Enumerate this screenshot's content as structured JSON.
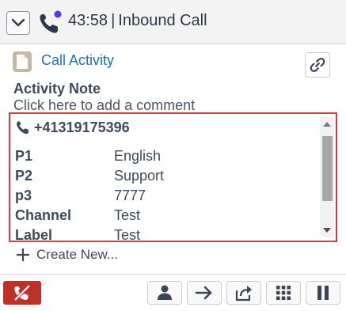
{
  "header": {
    "timer": "43:58",
    "separator": "|",
    "call_type": "Inbound Call",
    "status_dot_color": "#4a3fe0",
    "icon": "phone-icon"
  },
  "activity": {
    "link_label": "Call Activity",
    "note_label": "Activity Note",
    "note_placeholder": "Click here to add a comment",
    "icon": "document-icon",
    "link_button_icon": "link-icon"
  },
  "call_info": {
    "phone_number": "+41319175396",
    "attributes": [
      {
        "key": "P1",
        "value": "English"
      },
      {
        "key": "P2",
        "value": "Support"
      },
      {
        "key": "p3",
        "value": "7777"
      },
      {
        "key": "Channel",
        "value": "Test"
      },
      {
        "key": "Label",
        "value": "Test"
      }
    ],
    "highlight_color": "#d9393b"
  },
  "create_new": {
    "label": "Create New..."
  },
  "toolbar": {
    "hangup_color": "#c0302a",
    "buttons": [
      "consult-icon",
      "transfer-arrow-icon",
      "share-icon",
      "dialpad-icon",
      "pause-icon"
    ]
  }
}
